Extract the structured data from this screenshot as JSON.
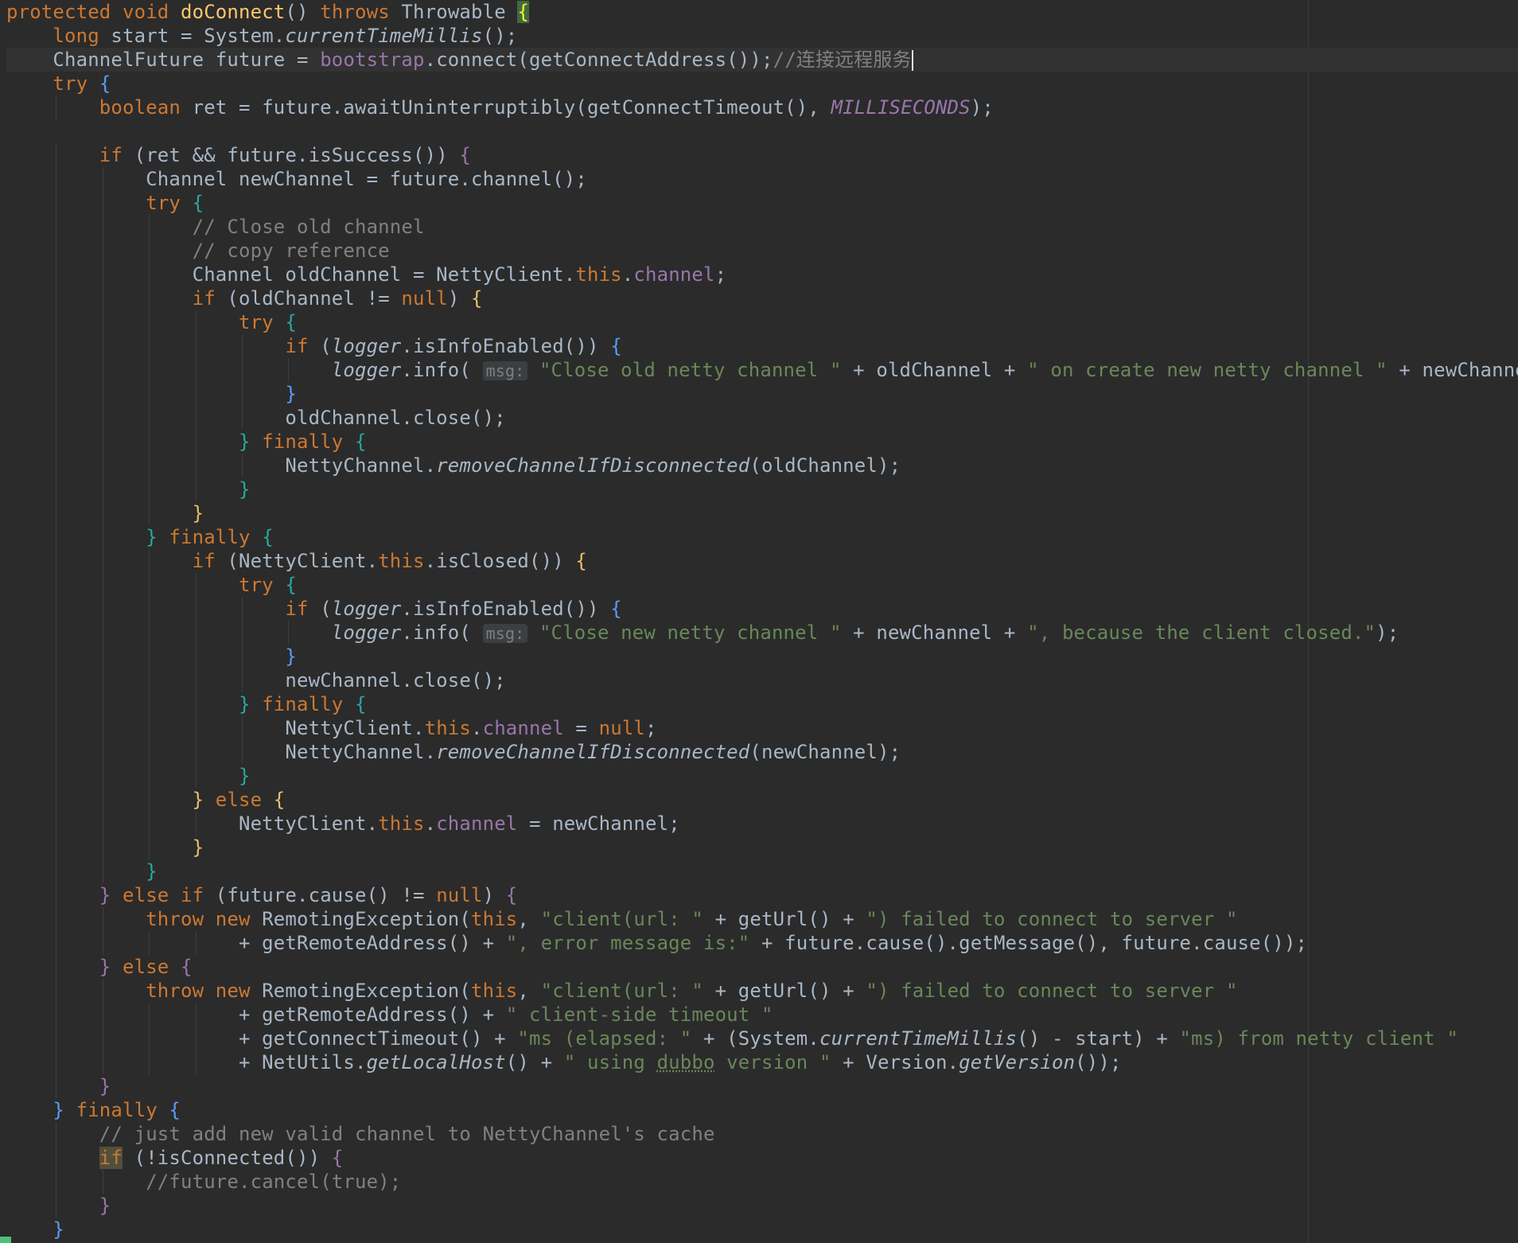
{
  "editor": {
    "language": "Java",
    "method_name": "doConnect",
    "colors": {
      "background": "#2b2b2b",
      "keyword": "#cc7832",
      "string": "#6a8759",
      "comment": "#808080",
      "field": "#9876aa",
      "method_decl": "#ffc66d",
      "default_text": "#a9b7c6"
    },
    "lines": [
      {
        "indent": 0,
        "tokens": [
          [
            "kw",
            "protected void "
          ],
          [
            "fn",
            "doConnect"
          ],
          [
            "t",
            "() "
          ],
          [
            "kw",
            "throws "
          ],
          [
            "t",
            "Throwable "
          ],
          [
            "mbrace",
            "{"
          ]
        ]
      },
      {
        "indent": 1,
        "tokens": [
          [
            "kw",
            "long "
          ],
          [
            "t",
            "start = System."
          ],
          [
            "it",
            "currentTimeMillis"
          ],
          [
            "t",
            "();"
          ]
        ]
      },
      {
        "indent": 1,
        "current": true,
        "tokens": [
          [
            "t",
            "ChannelFuture future = "
          ],
          [
            "fld",
            "bootstrap"
          ],
          [
            "t",
            ".connect(getConnectAddress());"
          ],
          [
            "cm",
            "//连接远程服务"
          ],
          [
            "cursor",
            ""
          ]
        ]
      },
      {
        "indent": 1,
        "tokens": [
          [
            "kw",
            "try "
          ],
          [
            "bb",
            "{"
          ]
        ]
      },
      {
        "indent": 2,
        "tokens": [
          [
            "kw",
            "boolean "
          ],
          [
            "t",
            "ret = future.awaitUninterruptibly(getConnectTimeout(), "
          ],
          [
            "sfld",
            "MILLISECONDS"
          ],
          [
            "t",
            ");"
          ]
        ]
      },
      {
        "indent": 0,
        "tokens": []
      },
      {
        "indent": 2,
        "tokens": [
          [
            "kw",
            "if "
          ],
          [
            "t",
            "(ret && future.isSuccess()) "
          ],
          [
            "bv",
            "{"
          ]
        ]
      },
      {
        "indent": 3,
        "tokens": [
          [
            "t",
            "Channel newChannel = future.channel();"
          ]
        ]
      },
      {
        "indent": 3,
        "tokens": [
          [
            "kw",
            "try "
          ],
          [
            "bc",
            "{"
          ]
        ]
      },
      {
        "indent": 4,
        "tokens": [
          [
            "cm",
            "// Close old channel"
          ]
        ]
      },
      {
        "indent": 4,
        "tokens": [
          [
            "cm",
            "// copy reference"
          ]
        ]
      },
      {
        "indent": 4,
        "tokens": [
          [
            "t",
            "Channel oldChannel = NettyClient."
          ],
          [
            "kw",
            "this"
          ],
          [
            "t",
            "."
          ],
          [
            "fld",
            "channel"
          ],
          [
            "t",
            ";"
          ]
        ]
      },
      {
        "indent": 4,
        "tokens": [
          [
            "kw",
            "if "
          ],
          [
            "t",
            "(oldChannel != "
          ],
          [
            "kw",
            "null"
          ],
          [
            "t",
            ") "
          ],
          [
            "by",
            "{"
          ]
        ]
      },
      {
        "indent": 5,
        "tokens": [
          [
            "kw",
            "try "
          ],
          [
            "bc",
            "{"
          ]
        ]
      },
      {
        "indent": 6,
        "tokens": [
          [
            "kw",
            "if "
          ],
          [
            "t",
            "("
          ],
          [
            "it",
            "logger"
          ],
          [
            "t",
            ".isInfoEnabled()) "
          ],
          [
            "bb",
            "{"
          ]
        ]
      },
      {
        "indent": 7,
        "tokens": [
          [
            "it",
            "logger"
          ],
          [
            "t",
            ".info( "
          ],
          [
            "hint",
            "msg:"
          ],
          [
            "str",
            " \"Close old netty channel \""
          ],
          [
            "t",
            " + oldChannel + "
          ],
          [
            "str",
            "\" on create new netty channel \""
          ],
          [
            "t",
            " + newChannel);"
          ]
        ]
      },
      {
        "indent": 6,
        "tokens": [
          [
            "bb",
            "}"
          ]
        ]
      },
      {
        "indent": 6,
        "tokens": [
          [
            "t",
            "oldChannel.close();"
          ]
        ]
      },
      {
        "indent": 5,
        "tokens": [
          [
            "bc",
            "} "
          ],
          [
            "kw",
            "finally "
          ],
          [
            "bc",
            "{"
          ]
        ]
      },
      {
        "indent": 6,
        "tokens": [
          [
            "t",
            "NettyChannel."
          ],
          [
            "it",
            "removeChannelIfDisconnected"
          ],
          [
            "t",
            "(oldChannel);"
          ]
        ]
      },
      {
        "indent": 5,
        "tokens": [
          [
            "bc",
            "}"
          ]
        ]
      },
      {
        "indent": 4,
        "tokens": [
          [
            "by",
            "}"
          ]
        ]
      },
      {
        "indent": 3,
        "tokens": [
          [
            "bc",
            "} "
          ],
          [
            "kw",
            "finally "
          ],
          [
            "bc",
            "{"
          ]
        ]
      },
      {
        "indent": 4,
        "tokens": [
          [
            "kw",
            "if "
          ],
          [
            "t",
            "(NettyClient."
          ],
          [
            "kw",
            "this"
          ],
          [
            "t",
            ".isClosed()) "
          ],
          [
            "by",
            "{"
          ]
        ]
      },
      {
        "indent": 5,
        "tokens": [
          [
            "kw",
            "try "
          ],
          [
            "bc",
            "{"
          ]
        ]
      },
      {
        "indent": 6,
        "tokens": [
          [
            "kw",
            "if "
          ],
          [
            "t",
            "("
          ],
          [
            "it",
            "logger"
          ],
          [
            "t",
            ".isInfoEnabled()) "
          ],
          [
            "bb",
            "{"
          ]
        ]
      },
      {
        "indent": 7,
        "tokens": [
          [
            "it",
            "logger"
          ],
          [
            "t",
            ".info( "
          ],
          [
            "hint",
            "msg:"
          ],
          [
            "str",
            " \"Close new netty channel \""
          ],
          [
            "t",
            " + newChannel + "
          ],
          [
            "str",
            "\", because the client closed.\""
          ],
          [
            "t",
            ");"
          ]
        ]
      },
      {
        "indent": 6,
        "tokens": [
          [
            "bb",
            "}"
          ]
        ]
      },
      {
        "indent": 6,
        "tokens": [
          [
            "t",
            "newChannel.close();"
          ]
        ]
      },
      {
        "indent": 5,
        "tokens": [
          [
            "bc",
            "} "
          ],
          [
            "kw",
            "finally "
          ],
          [
            "bc",
            "{"
          ]
        ]
      },
      {
        "indent": 6,
        "tokens": [
          [
            "t",
            "NettyClient."
          ],
          [
            "kw",
            "this"
          ],
          [
            "t",
            "."
          ],
          [
            "fld",
            "channel"
          ],
          [
            "t",
            " = "
          ],
          [
            "kw",
            "null"
          ],
          [
            "t",
            ";"
          ]
        ]
      },
      {
        "indent": 6,
        "tokens": [
          [
            "t",
            "NettyChannel."
          ],
          [
            "it",
            "removeChannelIfDisconnected"
          ],
          [
            "t",
            "(newChannel);"
          ]
        ]
      },
      {
        "indent": 5,
        "tokens": [
          [
            "bc",
            "}"
          ]
        ]
      },
      {
        "indent": 4,
        "tokens": [
          [
            "by",
            "} "
          ],
          [
            "kw",
            "else "
          ],
          [
            "by",
            "{"
          ]
        ]
      },
      {
        "indent": 5,
        "tokens": [
          [
            "t",
            "NettyClient."
          ],
          [
            "kw",
            "this"
          ],
          [
            "t",
            "."
          ],
          [
            "fld",
            "channel"
          ],
          [
            "t",
            " = newChannel;"
          ]
        ]
      },
      {
        "indent": 4,
        "tokens": [
          [
            "by",
            "}"
          ]
        ]
      },
      {
        "indent": 3,
        "tokens": [
          [
            "bc",
            "}"
          ]
        ]
      },
      {
        "indent": 2,
        "tokens": [
          [
            "bv",
            "} "
          ],
          [
            "kw",
            "else if "
          ],
          [
            "t",
            "(future.cause() != "
          ],
          [
            "kw",
            "null"
          ],
          [
            "t",
            ") "
          ],
          [
            "bv",
            "{"
          ]
        ]
      },
      {
        "indent": 3,
        "tokens": [
          [
            "kw",
            "throw new "
          ],
          [
            "t",
            "RemotingException("
          ],
          [
            "kw",
            "this"
          ],
          [
            "t",
            ", "
          ],
          [
            "str",
            "\"client(url: \""
          ],
          [
            "t",
            " + getUrl() + "
          ],
          [
            "str",
            "\") failed to connect to server \""
          ]
        ]
      },
      {
        "indent": 5,
        "tokens": [
          [
            "t",
            "+ getRemoteAddress() + "
          ],
          [
            "str",
            "\", error message is:\""
          ],
          [
            "t",
            " + future.cause().getMessage(), future.cause());"
          ]
        ]
      },
      {
        "indent": 2,
        "tokens": [
          [
            "bv",
            "} "
          ],
          [
            "kw",
            "else "
          ],
          [
            "bv",
            "{"
          ]
        ]
      },
      {
        "indent": 3,
        "tokens": [
          [
            "kw",
            "throw new "
          ],
          [
            "t",
            "RemotingException("
          ],
          [
            "kw",
            "this"
          ],
          [
            "t",
            ", "
          ],
          [
            "str",
            "\"client(url: \""
          ],
          [
            "t",
            " + getUrl() + "
          ],
          [
            "str",
            "\") failed to connect to server \""
          ]
        ]
      },
      {
        "indent": 5,
        "tokens": [
          [
            "t",
            "+ getRemoteAddress() + "
          ],
          [
            "str",
            "\" client-side timeout \""
          ]
        ]
      },
      {
        "indent": 5,
        "tokens": [
          [
            "t",
            "+ getConnectTimeout() + "
          ],
          [
            "str",
            "\"ms (elapsed: \""
          ],
          [
            "t",
            " + (System."
          ],
          [
            "it",
            "currentTimeMillis"
          ],
          [
            "t",
            "() - start) + "
          ],
          [
            "str",
            "\"ms) from netty client \""
          ]
        ]
      },
      {
        "indent": 5,
        "tokens": [
          [
            "t",
            "+ NetUtils."
          ],
          [
            "it",
            "getLocalHost"
          ],
          [
            "t",
            "() + "
          ],
          [
            "str",
            "\" using "
          ],
          [
            "strul",
            "dubbo"
          ],
          [
            "str",
            " version \""
          ],
          [
            "t",
            " + Version."
          ],
          [
            "it",
            "getVersion"
          ],
          [
            "t",
            "());"
          ]
        ]
      },
      {
        "indent": 2,
        "tokens": [
          [
            "bv",
            "}"
          ]
        ]
      },
      {
        "indent": 1,
        "tokens": [
          [
            "bb",
            "} "
          ],
          [
            "kw",
            "finally "
          ],
          [
            "bb",
            "{"
          ]
        ]
      },
      {
        "indent": 2,
        "tokens": [
          [
            "cm",
            "// just add new valid channel to NettyChannel's cache"
          ]
        ]
      },
      {
        "indent": 2,
        "tokens": [
          [
            "ifhl",
            "if"
          ],
          [
            "t",
            " (!isConnected()) "
          ],
          [
            "bv",
            "{"
          ]
        ]
      },
      {
        "indent": 3,
        "tokens": [
          [
            "cm",
            "//future.cancel(true);"
          ]
        ]
      },
      {
        "indent": 2,
        "tokens": [
          [
            "bv",
            "}"
          ]
        ]
      },
      {
        "indent": 1,
        "tokens": [
          [
            "bb",
            "}"
          ]
        ]
      }
    ]
  }
}
